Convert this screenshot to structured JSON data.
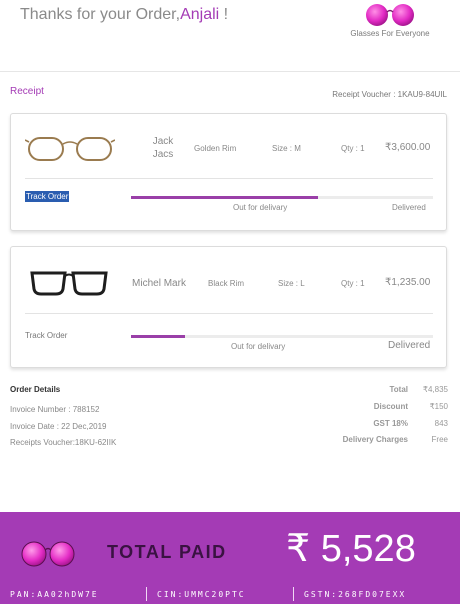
{
  "header": {
    "thanks_prefix": "Thanks for your Order,",
    "customer_name": "Anjali",
    "thanks_suffix": " !",
    "brand_tagline": "Glasses For Everyone",
    "brand_icon": "pink-glasses-logo"
  },
  "receipt": {
    "label": "Receipt",
    "voucher": "Receipt Voucher : 1KAU9-84UIL"
  },
  "orders": [
    {
      "product_name": "Jack Jacs",
      "rim": "Golden Rim",
      "size": "Size : M",
      "qty": "Qty : 1",
      "price": "₹3,600.00",
      "track_label": "Track Order",
      "status_label": "Out for delivary",
      "delivered_label": "Delivered",
      "progress": 0.62,
      "frame_color": "#9a7b4f"
    },
    {
      "product_name": "Michel Mark",
      "rim": "Black Rim",
      "size": "Size : L",
      "qty": "Qty : 1",
      "price": "₹1,235.00",
      "track_label": "Track Order",
      "status_label": "Out for delivary",
      "delivered_label": "Delivered",
      "progress": 0.18,
      "frame_color": "#1e1e1e"
    }
  ],
  "order_details": {
    "title": "Order Details",
    "invoice_number": "Invoice Number : 788152",
    "invoice_date": "Invoice Date : 22 Dec,2019",
    "receipts_voucher": "Receipts Voucher:18KU-62IIK"
  },
  "summary": [
    {
      "label": "Total",
      "value": "₹4,835"
    },
    {
      "label": "Discount",
      "value": "₹150"
    },
    {
      "label": "GST 18%",
      "value": "843"
    },
    {
      "label": "Delivery Charges",
      "value": "Free"
    }
  ],
  "footer": {
    "total_label": "TOTAL PAID",
    "total_value": "₹ 5,528",
    "pan": "PAN:AA02hDW7E",
    "cin": "CIN:UMMC20PTC",
    "gstn": "GSTN:268FD07EXX",
    "accent_color": "#a43bb5"
  }
}
